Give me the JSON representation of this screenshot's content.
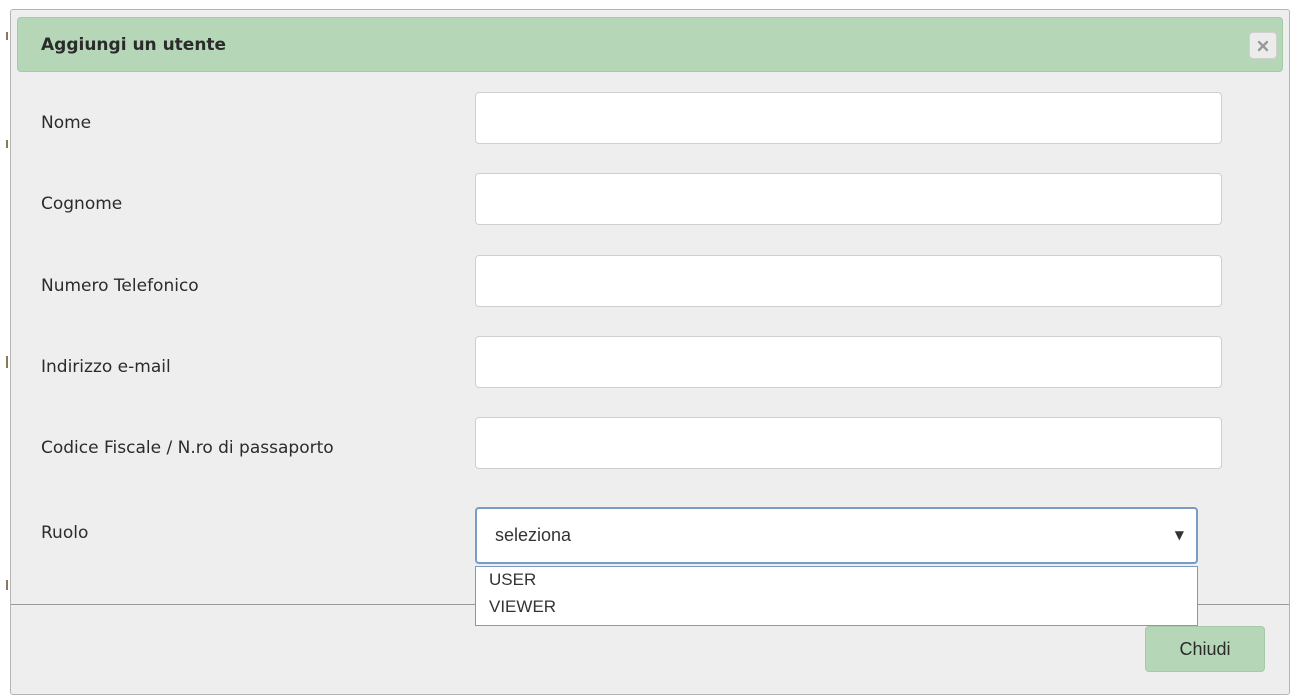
{
  "dialog": {
    "title": "Aggiungi un utente",
    "close_icon": "close-icon"
  },
  "form": {
    "fields": [
      {
        "label": "Nome",
        "value": "",
        "placeholder": ""
      },
      {
        "label": "Cognome",
        "value": "",
        "placeholder": ""
      },
      {
        "label": "Numero Telefonico",
        "value": "",
        "placeholder": ""
      },
      {
        "label": "Indirizzo e-mail",
        "value": "",
        "placeholder": ""
      },
      {
        "label": "Codice Fiscale / N.ro di passaporto",
        "value": "",
        "placeholder": ""
      }
    ],
    "role": {
      "label": "Ruolo",
      "selected": "seleziona",
      "options": [
        "USER",
        "VIEWER"
      ]
    }
  },
  "footer": {
    "close_label": "Chiudi"
  },
  "colors": {
    "header_bg": "#b5d6b7",
    "modal_bg": "#eeeeee",
    "select_border": "#7a9cc4",
    "button_bg": "#b5d6b7"
  }
}
